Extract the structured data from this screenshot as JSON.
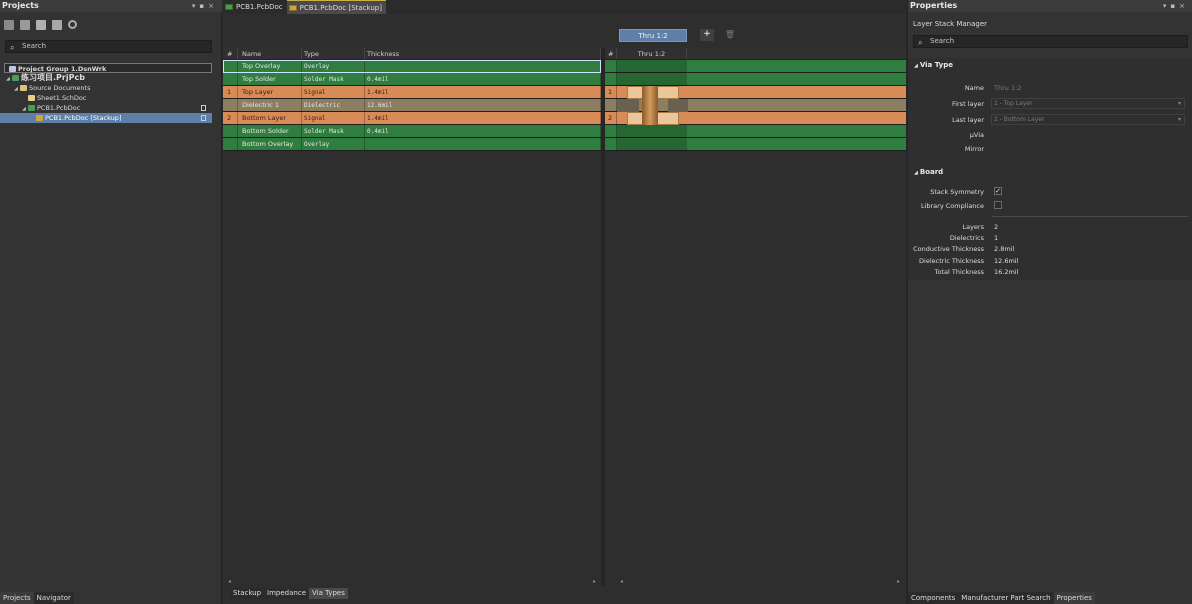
{
  "projects_panel": {
    "title": "Projects",
    "search_placeholder": "Search",
    "tree": [
      {
        "label": "Project Group 1.DsnWrk"
      },
      {
        "label": "练习项目.PrjPcb"
      },
      {
        "label": "Source Documents"
      },
      {
        "label": "Sheet1.SchDoc"
      },
      {
        "label": "PCB1.PcbDoc"
      },
      {
        "label": "PCB1.PcbDoc [Stackup]"
      }
    ],
    "bottom_tabs": [
      "Projects",
      "Navigator"
    ]
  },
  "doc_tabs": [
    "PCB1.PcbDoc",
    "PCB1.PcbDoc [Stackup]"
  ],
  "stack": {
    "via_column_label": "Thru 1:2",
    "add_label": "+",
    "headers": {
      "num": "#",
      "name": "Name",
      "type": "Type",
      "thickness": "Thickness"
    },
    "rows": [
      {
        "num": "",
        "name": "Top Overlay",
        "type": "Overlay",
        "thickness": ""
      },
      {
        "num": "",
        "name": "Top Solder",
        "type": "Solder Mask",
        "thickness": "0.4mil"
      },
      {
        "num": "1",
        "name": "Top Layer",
        "type": "Signal",
        "thickness": "1.4mil"
      },
      {
        "num": "",
        "name": "Dielectric 1",
        "type": "Dielectric",
        "thickness": "12.6mil"
      },
      {
        "num": "2",
        "name": "Bottom Layer",
        "type": "Signal",
        "thickness": "1.4mil"
      },
      {
        "num": "",
        "name": "Bottom Solder",
        "type": "Solder Mask",
        "thickness": "0.4mil"
      },
      {
        "num": "",
        "name": "Bottom Overlay",
        "type": "Overlay",
        "thickness": ""
      }
    ],
    "via_rows": [
      "",
      "",
      "1",
      "",
      "2",
      "",
      ""
    ],
    "bottom_tabs": [
      "Stackup",
      "Impedance",
      "Via Types"
    ]
  },
  "properties": {
    "title": "Properties",
    "subtitle": "Layer Stack Manager",
    "search_placeholder": "Search",
    "via_type": {
      "section": "Via Type",
      "name_label": "Name",
      "name_value": "Thru 1:2",
      "first_label": "First layer",
      "first_value": "1 - Top Layer",
      "last_label": "Last layer",
      "last_value": "2 - Bottom Layer",
      "uvia_label": "μVia",
      "mirror_label": "Mirror"
    },
    "board": {
      "section": "Board",
      "symmetry_label": "Stack Symmetry",
      "compliance_label": "Library Compliance",
      "layers_label": "Layers",
      "layers_value": "2",
      "dielectrics_label": "Dielectrics",
      "dielectrics_value": "1",
      "cond_label": "Conductive Thickness",
      "cond_value": "2.8mil",
      "diel_label": "Dielectric Thickness",
      "diel_value": "12.6mil",
      "total_label": "Total Thickness",
      "total_value": "16.2mil"
    },
    "bottom_tabs": [
      "Components",
      "Manufacturer Part Search",
      "Properties"
    ]
  }
}
